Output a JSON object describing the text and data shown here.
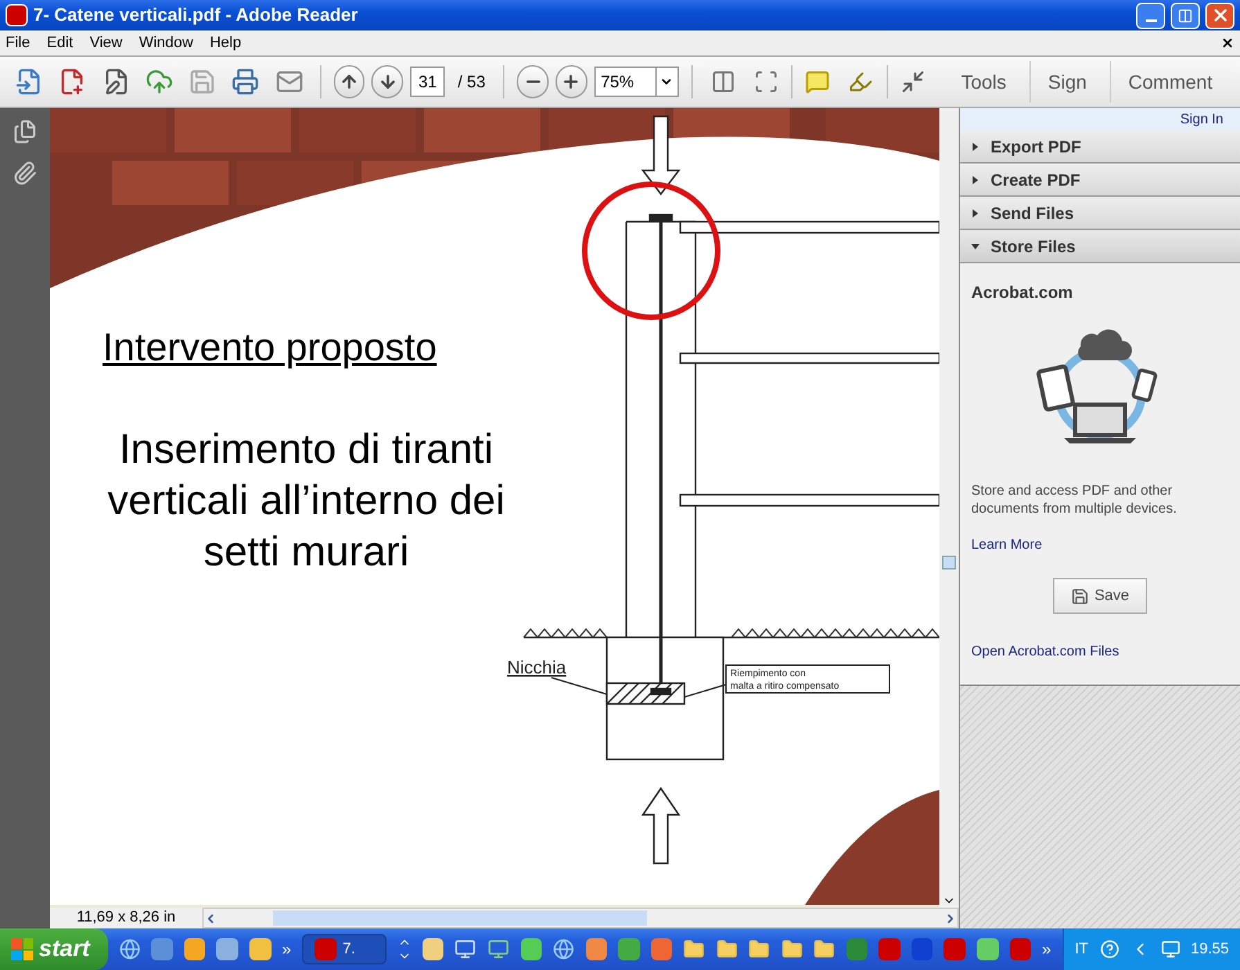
{
  "window": {
    "title": "7- Catene verticali.pdf - Adobe Reader"
  },
  "menu": [
    "File",
    "Edit",
    "View",
    "Window",
    "Help"
  ],
  "toolbar": {
    "page": "31",
    "page_total": "/ 53",
    "zoom": "75%",
    "tabs": [
      "Tools",
      "Sign",
      "Comment"
    ]
  },
  "document": {
    "heading": "Intervento proposto",
    "body": "Inserimento di tiranti verticali all’interno dei setti murari",
    "niche_label": "Nicchia",
    "fill_label": [
      "Riempimento con",
      "malta a ritiro compensato"
    ],
    "page_size": "11,69 x 8,26 in"
  },
  "panel": {
    "sign_in": "Sign In",
    "sections": [
      {
        "label": "Export PDF",
        "expanded": false
      },
      {
        "label": "Create PDF",
        "expanded": false
      },
      {
        "label": "Send Files",
        "expanded": false
      },
      {
        "label": "Store Files",
        "expanded": true
      }
    ],
    "heading": "Acrobat.com",
    "description": "Store and access PDF and other documents from multiple devices.",
    "learn_more": "Learn More",
    "save_button": "Save",
    "open_link": "Open Acrobat.com Files"
  },
  "taskbar": {
    "start": "start",
    "quick_more": "»",
    "task": "7.",
    "tray_more": "»",
    "language": "IT",
    "clock": "19.55"
  }
}
